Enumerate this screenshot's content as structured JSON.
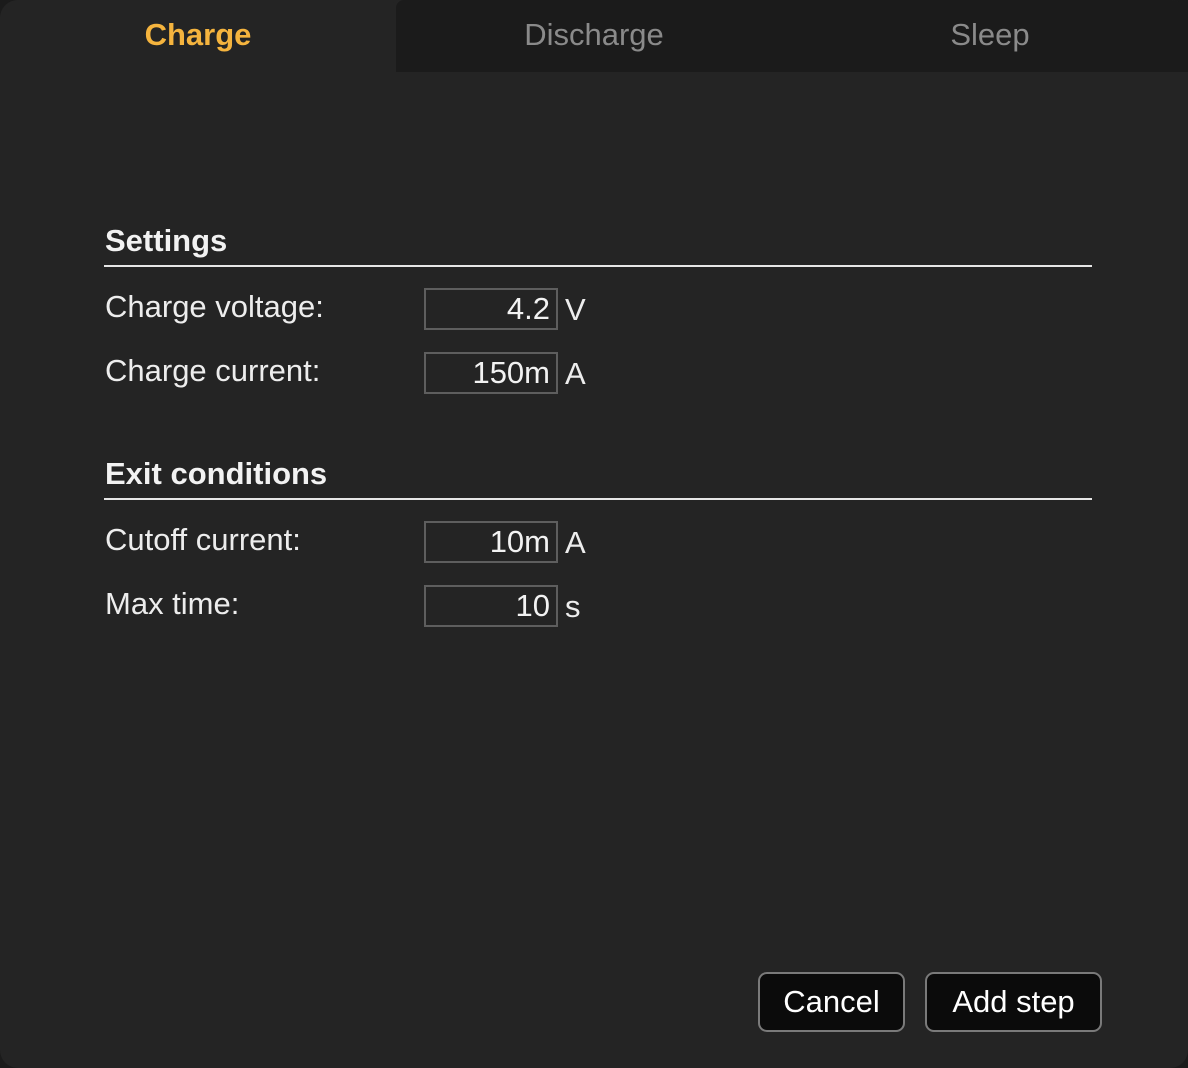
{
  "tabs": [
    {
      "label": "Charge",
      "active": true
    },
    {
      "label": "Discharge",
      "active": false
    },
    {
      "label": "Sleep",
      "active": false
    }
  ],
  "settings": {
    "title": "Settings",
    "fields": [
      {
        "label": "Charge voltage:",
        "value": "4.2",
        "unit": "V"
      },
      {
        "label": "Charge current:",
        "value": "150m",
        "unit": "A"
      }
    ]
  },
  "exit_conditions": {
    "title": "Exit conditions",
    "fields": [
      {
        "label": "Cutoff current:",
        "value": "10m",
        "unit": "A"
      },
      {
        "label": "Max time:",
        "value": "10",
        "unit": "s"
      }
    ]
  },
  "buttons": {
    "cancel_label": "Cancel",
    "add_step_label": "Add step"
  },
  "colors": {
    "accent": "#f5b43e",
    "background": "#242424",
    "tab_inactive_bg": "#1b1b1b"
  }
}
